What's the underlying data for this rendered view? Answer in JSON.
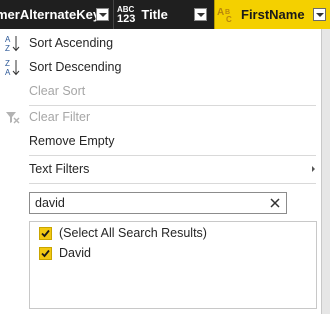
{
  "header": {
    "columns": [
      {
        "label": "merAlternateKey",
        "type_icon": "none",
        "selected": false
      },
      {
        "label": "Title",
        "type_icon": "text-type-icon",
        "type_top": "ABC",
        "type_bottom": "123",
        "selected": false
      },
      {
        "label": "FirstName",
        "type_icon": "abc-text-type-icon",
        "type_chars": [
          "A",
          "B",
          "C"
        ],
        "selected": true
      }
    ],
    "colors": {
      "bar": "#1f1f1f",
      "selected": "#f4d000"
    }
  },
  "menu": {
    "items": [
      {
        "label": "Sort Ascending",
        "icon": "sort-ascending-icon",
        "enabled": true
      },
      {
        "label": "Sort Descending",
        "icon": "sort-descending-icon",
        "enabled": true
      },
      {
        "label": "Clear Sort",
        "icon": "none",
        "enabled": false
      },
      {
        "label": "Clear Filter",
        "icon": "clear-filter-icon",
        "enabled": false
      },
      {
        "label": "Remove Empty",
        "icon": "none",
        "enabled": true
      },
      {
        "label": "Text Filters",
        "icon": "none",
        "enabled": true,
        "submenu": true
      }
    ],
    "search": {
      "value": "david",
      "placeholder": ""
    },
    "results": [
      {
        "label": "(Select All Search Results)",
        "checked": true
      },
      {
        "label": "David",
        "checked": true
      }
    ],
    "accent": "#f2c811"
  }
}
